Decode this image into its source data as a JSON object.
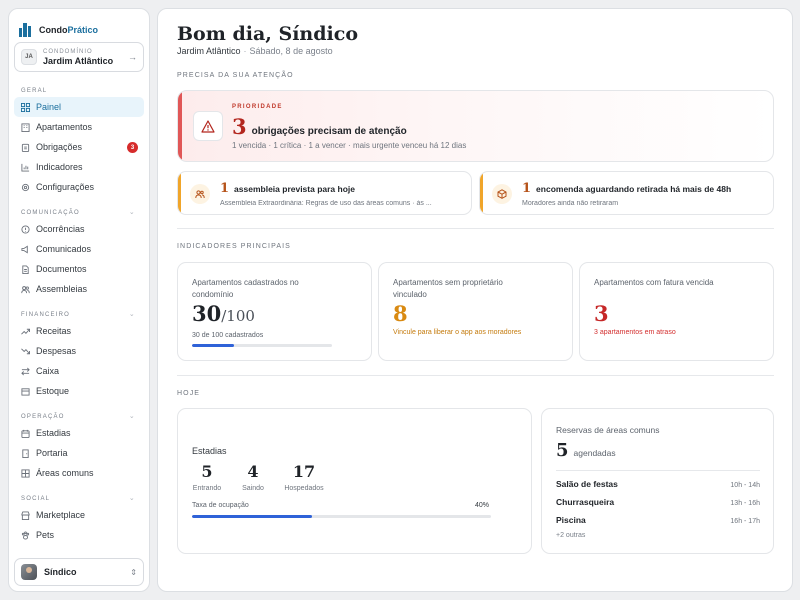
{
  "brand": {
    "name_prefix": "Condo",
    "name_accent": "Prático"
  },
  "condo": {
    "initials": "JA",
    "kicker": "CONDOMÍNIO",
    "name": "Jardim Atlântico"
  },
  "nav": {
    "geral": {
      "label": "GERAL",
      "items": [
        {
          "label": "Painel",
          "icon": "grid-icon",
          "active": true
        },
        {
          "label": "Apartamentos",
          "icon": "building-icon"
        },
        {
          "label": "Obrigações",
          "icon": "clipboard-icon",
          "badge": "3"
        },
        {
          "label": "Indicadores",
          "icon": "chart-icon"
        },
        {
          "label": "Configurações",
          "icon": "gear-icon"
        }
      ]
    },
    "comunicacao": {
      "label": "COMUNICAÇÃO",
      "items": [
        {
          "label": "Ocorrências",
          "icon": "alert-circle-icon"
        },
        {
          "label": "Comunicados",
          "icon": "megaphone-icon"
        },
        {
          "label": "Documentos",
          "icon": "document-icon"
        },
        {
          "label": "Assembleias",
          "icon": "users-icon"
        }
      ]
    },
    "financeiro": {
      "label": "FINANCEIRO",
      "items": [
        {
          "label": "Receitas",
          "icon": "trend-up-icon"
        },
        {
          "label": "Despesas",
          "icon": "trend-down-icon"
        },
        {
          "label": "Caixa",
          "icon": "swap-icon"
        },
        {
          "label": "Estoque",
          "icon": "box-icon"
        }
      ]
    },
    "operacao": {
      "label": "OPERAÇÃO",
      "items": [
        {
          "label": "Estadias",
          "icon": "calendar-icon"
        },
        {
          "label": "Portaria",
          "icon": "door-icon"
        },
        {
          "label": "Áreas comuns",
          "icon": "grid-icon"
        }
      ]
    },
    "social": {
      "label": "SOCIAL",
      "items": [
        {
          "label": "Marketplace",
          "icon": "store-icon"
        },
        {
          "label": "Pets",
          "icon": "paw-icon"
        }
      ]
    }
  },
  "user": {
    "name": "Síndico"
  },
  "header": {
    "greeting": "Bom dia, Síndico",
    "condo": "Jardim Atlântico",
    "separator": "·",
    "date": "Sábado, 8 de agosto"
  },
  "attention": {
    "label": "PRECISA DA SUA ATENÇÃO",
    "priority": {
      "kicker": "PRIORIDADE",
      "count": "3",
      "title": "obrigações precisam de atenção",
      "detail": "1 vencida · 1 crítica · 1 a vencer · mais urgente venceu há 12 dias"
    },
    "assembly": {
      "count": "1",
      "title": "assembleia prevista para hoje",
      "sub": "Assembleia Extraordinária: Regras de uso das áreas comuns · às ..."
    },
    "parcel": {
      "count": "1",
      "title": "encomenda aguardando retirada há mais de 48h",
      "sub": "Moradores ainda não retiraram"
    }
  },
  "indicators": {
    "label": "INDICADORES PRINCIPAIS",
    "registered": {
      "label": "Apartamentos cadastrados no condomínio",
      "value": "30",
      "denominator": "/100",
      "sub": "30 de 100 cadastrados",
      "progress": 0.3
    },
    "no_owner": {
      "label": "Apartamentos sem proprietário vinculado",
      "value": "8",
      "sub": "Vincule para liberar o app aos moradores"
    },
    "overdue": {
      "label": "Apartamentos com fatura vencida",
      "value": "3",
      "sub": "3 apartamentos em atraso"
    }
  },
  "today": {
    "label": "HOJE",
    "stays": {
      "title": "Estadias",
      "stats": [
        {
          "value": "5",
          "label": "Entrando"
        },
        {
          "value": "4",
          "label": "Saindo"
        },
        {
          "value": "17",
          "label": "Hospedados"
        }
      ],
      "occupancy_label": "Taxa de ocupação",
      "occupancy_value": "40%",
      "occupancy": 0.4
    },
    "reservations": {
      "title": "Reservas de áreas comuns",
      "count": "5",
      "count_label": "agendadas",
      "items": [
        {
          "name": "Salão de festas",
          "time": "10h - 14h"
        },
        {
          "name": "Churrasqueira",
          "time": "13h - 16h"
        },
        {
          "name": "Piscina",
          "time": "16h - 17h"
        }
      ],
      "more": "+2 outras"
    }
  },
  "colors": {
    "accent": "#1b6f9e",
    "danger": "#b3261e",
    "warning": "#d98a12",
    "progress": "#2f62d8"
  }
}
